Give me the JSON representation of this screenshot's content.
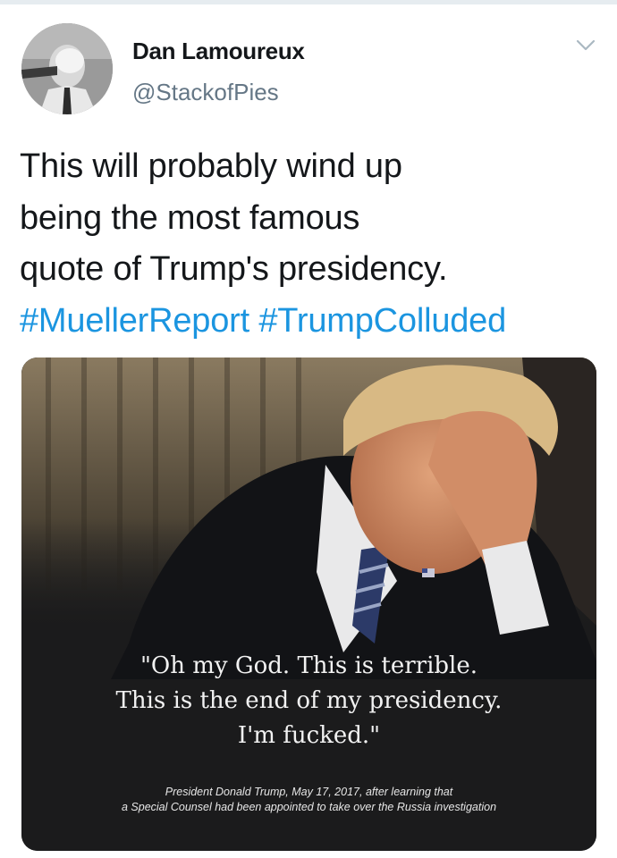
{
  "tweet": {
    "author_name": "Dan Lamoureux",
    "author_handle": "@StackofPies",
    "avatar_icon": "avatar-pie-face",
    "menu_icon": "chevron-down-icon",
    "text_lines": [
      "This will probably wind up",
      "being the most famous",
      "quote of Trump's presidency."
    ],
    "hashtags": [
      "#MuellerReport",
      "#TrumpColluded"
    ],
    "colors": {
      "hashtag": "#1b95e0",
      "name": "#14171a",
      "handle": "#657786"
    }
  },
  "media": {
    "quote_lines": [
      "\"Oh my God. This is terrible.",
      "This is the end of my presidency.",
      "I'm fucked.\""
    ],
    "caption_lines": [
      "President Donald Trump, May 17, 2017, after learning that",
      "a Special Counsel had been appointed to take over the Russia investigation"
    ]
  }
}
